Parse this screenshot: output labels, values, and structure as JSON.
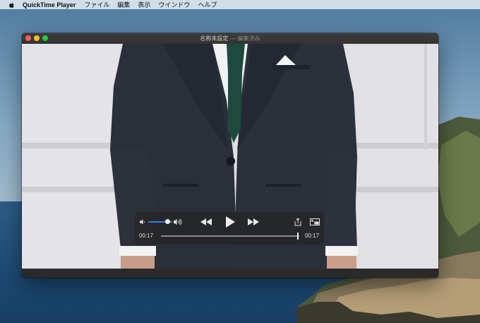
{
  "menubar": {
    "apple_icon": "apple-logo-icon",
    "app_name": "QuickTime Player",
    "items": [
      "ファイル",
      "編集",
      "表示",
      "ウインドウ",
      "ヘルプ"
    ]
  },
  "window": {
    "title": "名称未設定",
    "subtitle": "— 編集済み"
  },
  "controls": {
    "volume_level": 0.8,
    "time_current": "00:17",
    "time_total": "00:17",
    "progress": 1.0,
    "icons": {
      "volume_low": "volume-low-icon",
      "volume_high": "volume-high-icon",
      "rewind": "rewind-icon",
      "play": "play-icon",
      "forward": "fast-forward-icon",
      "share": "share-icon",
      "pip": "picture-in-picture-icon"
    }
  },
  "colors": {
    "close": "#fe5f57",
    "minimize": "#febc2e",
    "zoom": "#28c840",
    "volume_accent": "#2f7fe8"
  }
}
